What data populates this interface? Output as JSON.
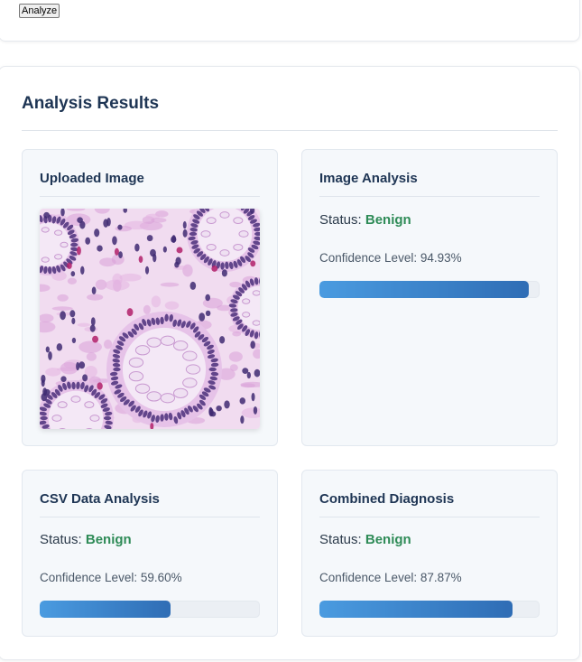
{
  "toolbar": {
    "analyze_label": "Analyze"
  },
  "results": {
    "title": "Analysis Results",
    "uploaded_image": {
      "title": "Uploaded Image"
    },
    "image_analysis": {
      "title": "Image Analysis",
      "status_label": "Status:",
      "status_value": "Benign",
      "confidence_text": "Confidence Level: 94.93%",
      "confidence": 94.93
    },
    "csv_analysis": {
      "title": "CSV Data Analysis",
      "status_label": "Status:",
      "status_value": "Benign",
      "confidence_text": "Confidence Level: 59.60%",
      "confidence": 59.6
    },
    "combined": {
      "title": "Combined Diagnosis",
      "status_label": "Status:",
      "status_value": "Benign",
      "confidence_text": "Confidence Level: 87.87%",
      "confidence": 87.87
    }
  },
  "colors": {
    "heading": "#1e3554",
    "status_benign": "#2e8b57",
    "bar_start": "#4a9be0",
    "bar_end": "#2f6db5"
  }
}
